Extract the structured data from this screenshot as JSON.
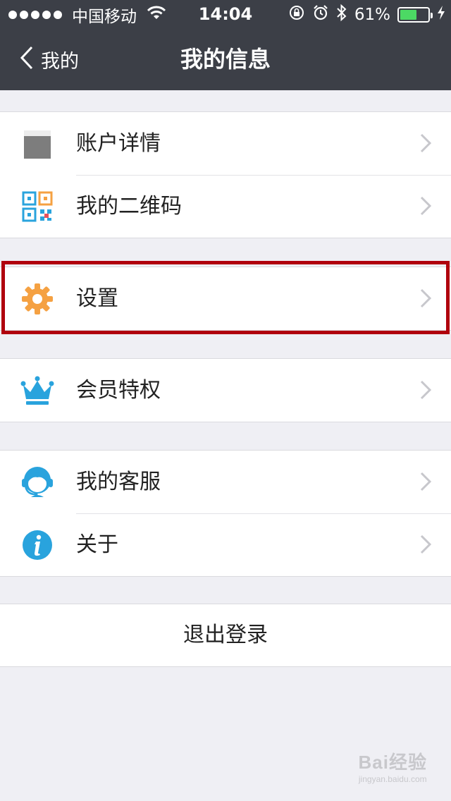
{
  "status_bar": {
    "carrier": "中国移动",
    "time": "14:04",
    "battery_percent": "61%",
    "battery_level": 0.61,
    "icons": [
      "signal-dots",
      "wifi-icon",
      "rotation-lock-icon",
      "alarm-icon",
      "bluetooth-icon",
      "battery-icon",
      "charging-icon"
    ]
  },
  "nav": {
    "back_label": "我的",
    "title": "我的信息"
  },
  "groups": [
    {
      "items": [
        {
          "label": "账户详情",
          "icon": "avatar-placeholder"
        },
        {
          "label": "我的二维码",
          "icon": "qr-code-icon"
        }
      ]
    },
    {
      "items": [
        {
          "label": "设置",
          "icon": "gear-icon"
        }
      ]
    },
    {
      "items": [
        {
          "label": "会员特权",
          "icon": "crown-icon"
        }
      ]
    },
    {
      "items": [
        {
          "label": "我的客服",
          "icon": "customer-service-icon"
        },
        {
          "label": "关于",
          "icon": "info-icon"
        }
      ]
    }
  ],
  "logout_label": "退出登录",
  "watermark": {
    "brand": "Bai经验",
    "url": "jingyan.baidu.com"
  },
  "colors": {
    "header_bg": "#3c3f47",
    "highlight_border": "#b0000d",
    "gear_orange": "#f5a142",
    "accent_blue": "#29a3dd",
    "battery_green": "#4cd964"
  }
}
